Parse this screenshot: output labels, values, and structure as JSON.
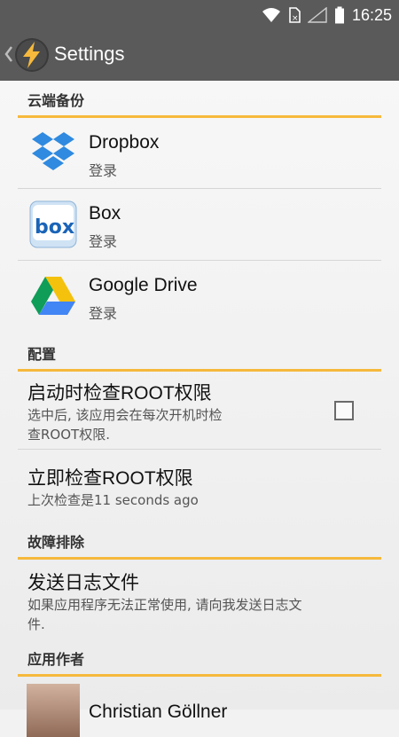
{
  "status_bar": {
    "time": "16:25",
    "icons": [
      "wifi-icon",
      "sim-icon",
      "signal-icon",
      "battery-icon"
    ]
  },
  "action_bar": {
    "title": "Settings",
    "app_icon": "lightning-app-icon",
    "up_icon": "chevron-left-icon"
  },
  "sections": {
    "cloud_backup": {
      "header": "云端备份",
      "accounts": [
        {
          "title": "Dropbox",
          "subtitle": "登录",
          "icon": "dropbox-icon"
        },
        {
          "title": "Box",
          "subtitle": "登录",
          "icon": "box-icon"
        },
        {
          "title": "Google Drive",
          "subtitle": "登录",
          "icon": "google-drive-icon"
        }
      ]
    },
    "config": {
      "header": "配置",
      "check_root_on_boot": {
        "title": "启动时检查ROOT权限",
        "summary_line1": "选中后, 该应用会在每次开机时检",
        "summary_line2": "查ROOT权限.",
        "checked": false
      },
      "check_root_now": {
        "title": "立即检查ROOT权限",
        "summary": "上次检查是11 seconds ago"
      }
    },
    "troubleshoot": {
      "header": "故障排除",
      "send_log": {
        "title": "发送日志文件",
        "summary_line1": "如果应用程序无法正常使用, 请向我发送日志文",
        "summary_line2": "件."
      }
    },
    "author": {
      "header": "应用作者",
      "name": "Christian Göllner"
    }
  },
  "colors": {
    "action_bar": "#5a5a5a",
    "accent": "#f6b93c"
  }
}
